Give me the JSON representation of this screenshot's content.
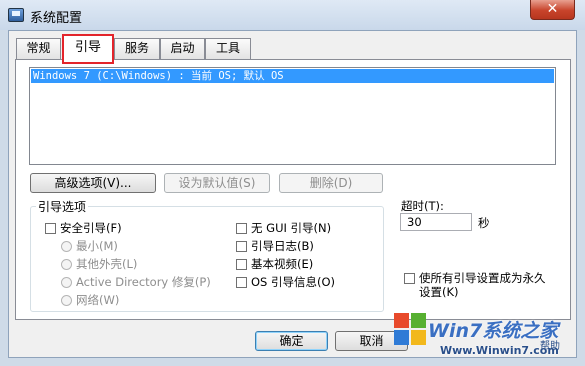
{
  "window": {
    "title": "系统配置",
    "close_label": "✕"
  },
  "tabs": [
    "常规",
    "引导",
    "服务",
    "启动",
    "工具"
  ],
  "os_list": {
    "items": [
      "Windows 7 (C:\\Windows) : 当前 OS; 默认 OS"
    ],
    "selected_index": 0
  },
  "buttons": {
    "advanced": "高级选项(V)...",
    "set_default": "设为默认值(S)",
    "delete": "删除(D)",
    "ok": "确定",
    "cancel": "取消",
    "help": "帮助"
  },
  "boot_options": {
    "label": "引导选项",
    "safe_boot": "安全引导(F)",
    "minimal": "最小(M)",
    "alternate_shell": "其他外壳(L)",
    "ad_repair": "Active Directory 修复(P)",
    "network": "网络(W)",
    "no_gui": "无 GUI 引导(N)",
    "boot_log": "引导日志(B)",
    "base_video": "基本视频(E)",
    "os_info": "OS 引导信息(O)"
  },
  "timeout": {
    "label": "超时(T):",
    "value": "30",
    "unit": "秒"
  },
  "permanent": {
    "line1": "使所有引导设置成为永久",
    "line2": "设置(K)"
  },
  "watermark": {
    "title": "Win7系统之家",
    "url": "Www.Winwin7.com",
    "url_suffix": "帮助"
  },
  "colors": {
    "selection": "#3399ff",
    "highlight_box": "#e3242b",
    "titlebar": "#cfdbe8"
  }
}
